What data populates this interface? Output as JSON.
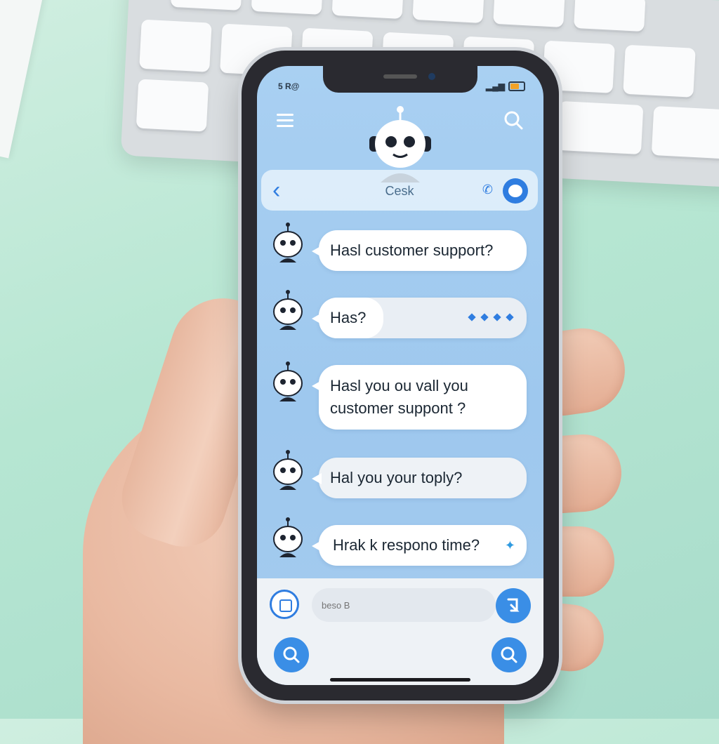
{
  "status_bar": {
    "left": "5 R@"
  },
  "header": {
    "menu_icon": "hamburger-menu-icon",
    "search_icon": "search-icon",
    "avatar_icon": "robot-icon"
  },
  "nav": {
    "back_icon": "chevron-left-icon",
    "title": "Cesk",
    "call_icon": "phone-icon",
    "toggle_icon": "toggle-icon"
  },
  "messages": [
    {
      "text": "Hasl customer support?"
    },
    {
      "text": "Has?",
      "typing": true
    },
    {
      "text_line1": "Hasl you ou vall you",
      "text_line2": "customer suppont ?"
    },
    {
      "text": "Hal you your toply?"
    },
    {
      "text": "Hrak k respono time?"
    }
  ],
  "composer": {
    "placeholder": "beso B",
    "attach_icon": "image-icon",
    "send_icon": "send-icon",
    "search_icon": "search-icon"
  },
  "colors": {
    "accent": "#2f7de0",
    "screen_bg": "#a9d0f2",
    "bubble": "#ffffff"
  }
}
